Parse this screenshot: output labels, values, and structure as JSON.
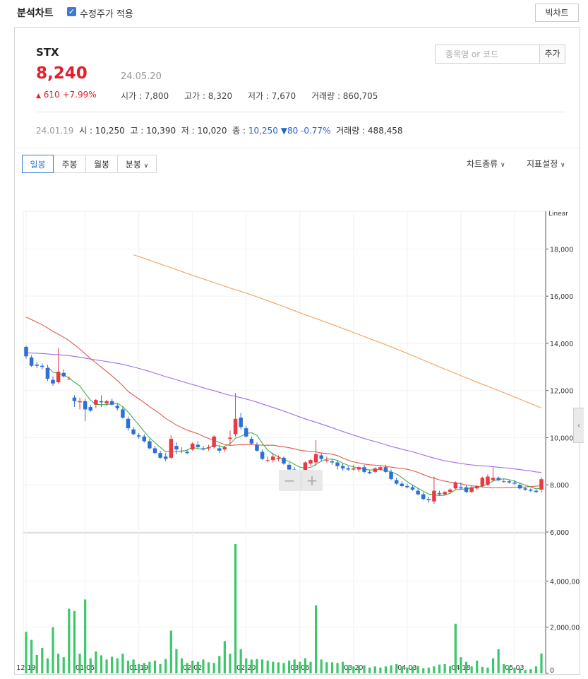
{
  "header": {
    "title": "분석차트",
    "adjusted_label": "수정주가 적용",
    "big_chart_label": "빅차트"
  },
  "stock": {
    "name": "STX",
    "price": "8,240",
    "date": "24.05.20",
    "change": "610 +7.99%",
    "open_label": "시가",
    "open": "7,800",
    "high_label": "고가",
    "high": "8,320",
    "low_label": "저가",
    "low": "7,670",
    "volume_label": "거래량",
    "volume": "860,705"
  },
  "search": {
    "placeholder": "종목명 or 코드",
    "add_label": "추가"
  },
  "previous": {
    "date": "24.01.19",
    "open_label": "시",
    "open": "10,250",
    "high_label": "고",
    "high": "10,390",
    "low_label": "저",
    "low": "10,020",
    "close_label": "종",
    "close": "10,250",
    "change": "80 -0.77%",
    "volume_label": "거래량",
    "volume": "488,458"
  },
  "toolbar": {
    "tabs": [
      "일봉",
      "주봉",
      "월봉",
      "분봉"
    ],
    "chart_type_label": "차트종류",
    "indicator_label": "지표설정"
  },
  "colors": {
    "up": "#e83a45",
    "down": "#2d6fd6",
    "volume": "#3cc76a",
    "ma5": "#3cb44b",
    "ma20": "#e05a4a",
    "ma60": "#a26bea",
    "ma120": "#f0a15a"
  },
  "chart_data": {
    "type": "candlestick",
    "scale_label": "Linear",
    "price_axis": {
      "ticks": [
        "18,000",
        "16,000",
        "14,000",
        "12,000",
        "10,000",
        "8,000",
        "6,000"
      ],
      "ylim": [
        6000,
        19600
      ]
    },
    "volume_axis": {
      "ticks": [
        "4,000,000",
        "2,000,000",
        "0"
      ],
      "ylim": [
        0,
        6000000
      ]
    },
    "x_tick_labels": [
      "12.19",
      "01.05",
      "01.19",
      "02.02",
      "02.20",
      "03.06",
      "03.20",
      "04.03",
      "04.18",
      "05.03"
    ],
    "x_tick_index": [
      0,
      11,
      21,
      31,
      41,
      51,
      61,
      71,
      81,
      91
    ],
    "ohlc": [
      [
        13850,
        13900,
        13350,
        13450
      ],
      [
        13400,
        13500,
        13000,
        13050
      ],
      [
        13100,
        13200,
        12950,
        13050
      ],
      [
        13050,
        13150,
        12900,
        13000
      ],
      [
        12950,
        13100,
        12400,
        12500
      ],
      [
        12450,
        12600,
        12200,
        12300
      ],
      [
        12350,
        13800,
        12300,
        12800
      ],
      [
        12750,
        12900,
        12550,
        12600
      ],
      [
        12500,
        12600,
        12450,
        12500
      ],
      [
        11700,
        11800,
        11300,
        11550
      ],
      [
        11500,
        11700,
        11200,
        11550
      ],
      [
        11550,
        11650,
        10700,
        11200
      ],
      [
        11300,
        11400,
        11100,
        11150
      ],
      [
        11400,
        11650,
        11250,
        11600
      ],
      [
        11550,
        11800,
        11300,
        11500
      ],
      [
        11450,
        11600,
        11350,
        11550
      ],
      [
        11550,
        11650,
        11350,
        11400
      ],
      [
        11350,
        11450,
        11150,
        11250
      ],
      [
        11200,
        11300,
        10800,
        10850
      ],
      [
        10800,
        10900,
        10300,
        10400
      ],
      [
        10350,
        10450,
        10100,
        10150
      ],
      [
        10100,
        10200,
        9950,
        10050
      ],
      [
        10050,
        10150,
        9800,
        9850
      ],
      [
        9850,
        9950,
        9500,
        9550
      ],
      [
        9550,
        9650,
        9300,
        9350
      ],
      [
        9350,
        9450,
        9100,
        9150
      ],
      [
        9200,
        9350,
        9000,
        9100
      ],
      [
        9150,
        10100,
        9100,
        9950
      ],
      [
        9650,
        9800,
        9300,
        9500
      ],
      [
        9450,
        9600,
        9350,
        9450
      ],
      [
        9400,
        9500,
        9300,
        9350
      ],
      [
        9500,
        9800,
        9450,
        9750
      ],
      [
        9700,
        9850,
        9550,
        9600
      ],
      [
        9550,
        9650,
        9450,
        9500
      ],
      [
        9550,
        9700,
        9450,
        9600
      ],
      [
        9600,
        10100,
        9550,
        10050
      ],
      [
        9550,
        9700,
        9350,
        9450
      ],
      [
        9500,
        9650,
        9400,
        9600
      ],
      [
        9950,
        10300,
        9700,
        10000
      ],
      [
        10150,
        11900,
        10050,
        10800
      ],
      [
        10850,
        11050,
        10350,
        10450
      ],
      [
        10400,
        10500,
        10000,
        10050
      ],
      [
        9950,
        10050,
        9700,
        9750
      ],
      [
        9700,
        9800,
        9400,
        9450
      ],
      [
        9400,
        9500,
        9050,
        9100
      ],
      [
        9050,
        9200,
        8950,
        9050
      ],
      [
        9050,
        9350,
        8950,
        9200
      ],
      [
        9100,
        9250,
        9000,
        9150
      ],
      [
        9150,
        9200,
        8850,
        8900
      ],
      [
        8850,
        8950,
        8600,
        8650
      ],
      [
        8650,
        8750,
        8400,
        8450
      ],
      [
        8450,
        8650,
        8400,
        8600
      ],
      [
        8600,
        9000,
        8550,
        8950
      ],
      [
        8900,
        9100,
        8800,
        9050
      ],
      [
        8950,
        9900,
        8800,
        9300
      ],
      [
        9250,
        9350,
        9000,
        9100
      ],
      [
        9050,
        9200,
        8950,
        9050
      ],
      [
        9000,
        9100,
        8850,
        8950
      ],
      [
        8950,
        9050,
        8650,
        8800
      ],
      [
        8800,
        8900,
        8600,
        8700
      ],
      [
        8700,
        8800,
        8600,
        8650
      ],
      [
        8650,
        8850,
        8600,
        8700
      ],
      [
        8650,
        8800,
        8550,
        8750
      ],
      [
        8750,
        8850,
        8500,
        8550
      ],
      [
        8550,
        8650,
        8450,
        8500
      ],
      [
        8550,
        8750,
        8500,
        8700
      ],
      [
        8650,
        8800,
        8600,
        8750
      ],
      [
        8750,
        8850,
        8500,
        8550
      ],
      [
        8550,
        8650,
        8200,
        8250
      ],
      [
        8200,
        8300,
        8000,
        8050
      ],
      [
        8050,
        8150,
        7900,
        7950
      ],
      [
        7950,
        8050,
        7850,
        7900
      ],
      [
        7900,
        8000,
        7750,
        7800
      ],
      [
        7750,
        7850,
        7550,
        7600
      ],
      [
        7600,
        7700,
        7350,
        7400
      ],
      [
        7400,
        7500,
        7250,
        7350
      ],
      [
        7300,
        8350,
        7200,
        7750
      ],
      [
        7650,
        7750,
        7550,
        7600
      ],
      [
        7600,
        7750,
        7550,
        7700
      ],
      [
        7700,
        7850,
        7650,
        7800
      ],
      [
        7850,
        8150,
        7800,
        8100
      ],
      [
        7900,
        8100,
        7800,
        7850
      ],
      [
        7900,
        8000,
        7650,
        7700
      ],
      [
        7700,
        7950,
        7650,
        7900
      ],
      [
        7850,
        8000,
        7800,
        7950
      ],
      [
        7950,
        8350,
        7900,
        8300
      ],
      [
        8000,
        8450,
        7950,
        8350
      ],
      [
        8200,
        8750,
        8150,
        8300
      ],
      [
        8300,
        8350,
        8150,
        8200
      ],
      [
        8150,
        8250,
        8100,
        8150
      ],
      [
        8150,
        8200,
        8050,
        8100
      ],
      [
        8100,
        8200,
        8000,
        8050
      ],
      [
        8000,
        8100,
        7800,
        7850
      ],
      [
        7850,
        7900,
        7750,
        7800
      ],
      [
        7800,
        7850,
        7700,
        7750
      ],
      [
        7750,
        7800,
        7650,
        7700
      ],
      [
        7800,
        8320,
        7670,
        8240
      ]
    ],
    "volume": [
      1800000,
      1450000,
      800000,
      1100000,
      650000,
      2000000,
      850000,
      700000,
      2800000,
      2700000,
      850000,
      3200000,
      650000,
      950000,
      780000,
      600000,
      720000,
      650000,
      850000,
      550000,
      600000,
      400000,
      450000,
      500000,
      550000,
      400000,
      620000,
      1850000,
      1050000,
      650000,
      450000,
      550000,
      500000,
      600000,
      480000,
      450000,
      750000,
      1400000,
      850000,
      5600000,
      1050000,
      650000,
      600000,
      620000,
      600000,
      550000,
      500000,
      480000,
      450000,
      550000,
      600000,
      500000,
      650000,
      500000,
      2950000,
      600000,
      480000,
      480000,
      450000,
      500000,
      350000,
      300000,
      350000,
      350000,
      250000,
      300000,
      250000,
      300000,
      350000,
      400000,
      300000,
      250000,
      300000,
      320000,
      220000,
      250000,
      300000,
      380000,
      400000,
      320000,
      2150000,
      700000,
      500000,
      300000,
      550000,
      280000,
      250000,
      650000,
      1050000,
      400000,
      300000,
      250000,
      220000,
      150000,
      180000,
      300000,
      860705
    ]
  }
}
